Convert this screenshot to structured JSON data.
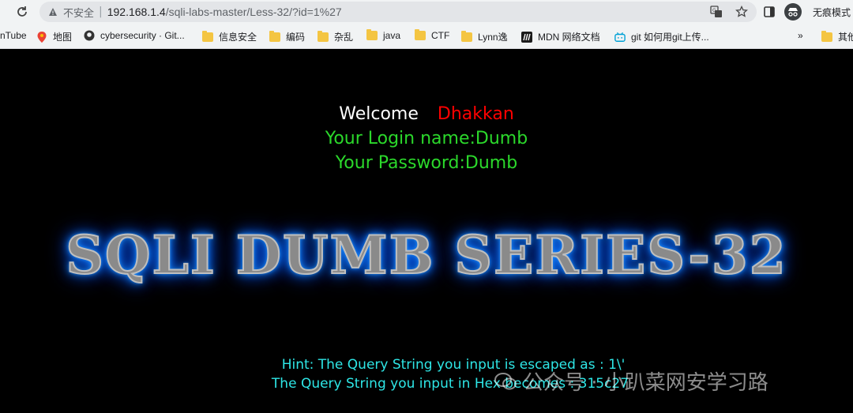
{
  "browser": {
    "insecure_label": "不安全",
    "url_host": "192.168.1.4",
    "url_path": "/sqli-labs-master/Less-32/?id=1%27",
    "incognito_label": "无痕模式"
  },
  "bookmarks": {
    "items": [
      {
        "label": "nTube",
        "icon": "youtube-icon"
      },
      {
        "label": "地图",
        "icon": "maps-icon"
      },
      {
        "label": "cybersecurity · Git...",
        "icon": "github-icon"
      },
      {
        "label": "信息安全",
        "icon": "folder-icon"
      },
      {
        "label": "编码",
        "icon": "folder-icon"
      },
      {
        "label": "杂乱",
        "icon": "folder-icon"
      },
      {
        "label": "java",
        "icon": "folder-icon"
      },
      {
        "label": "CTF",
        "icon": "folder-icon"
      },
      {
        "label": "Lynn逸",
        "icon": "folder-icon"
      },
      {
        "label": "MDN 网络文档",
        "icon": "mdn-icon"
      },
      {
        "label": "git 如何用git上传...",
        "icon": "bilibili-icon"
      }
    ],
    "overflow": "»",
    "other_label": "其他"
  },
  "page": {
    "welcome_label": "Welcome",
    "welcome_name": "Dhakkan",
    "login_line": "Your Login name:Dumb",
    "password_line": "Your Password:Dumb",
    "banner": "SQLI DUMB SERIES-32",
    "hint_line": "Hint: The Query String you input is escaped as : 1\\'",
    "hex_line": "The Query String you input in Hex becomes : 315c27"
  },
  "watermark": {
    "text": "公众号 · 小趴菜网安学习路"
  },
  "colors": {
    "welcome_name": "#ff0000",
    "credentials": "#2bd82b",
    "hint": "#2ee6e6",
    "banner_glow": "#1e90ff"
  }
}
